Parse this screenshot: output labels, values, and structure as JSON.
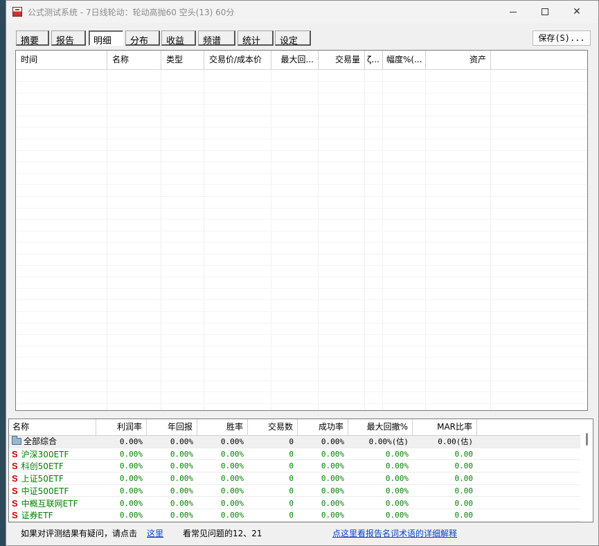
{
  "window": {
    "title": "公式测试系统 - 7日线轮动：轮动高抛60 空头(13) 60分"
  },
  "tabs": [
    "摘要",
    "报告",
    "明细",
    "分布",
    "收益",
    "频谱",
    "统计",
    "设定"
  ],
  "active_tab": "明细",
  "save_label": "保存(S)...",
  "detail_columns": [
    "时间",
    "名称",
    "类型",
    "交易价/成本价",
    "最大回...",
    "交易量",
    "ζ...",
    "幅度%(...",
    "资产"
  ],
  "summary": {
    "columns": [
      "名称",
      "利润率",
      "年回报",
      "胜率",
      "交易数",
      "成功率",
      "最大回撤%",
      "MAR比率"
    ],
    "rows": [
      {
        "name": "全部综合",
        "profit": "0.00%",
        "annual": "0.00%",
        "win": "0.00%",
        "trades": "0",
        "success": "0.00%",
        "drawdown": "0.00%(估)",
        "mar": "0.00(估)"
      },
      {
        "name": "沪深300ETF",
        "profit": "0.00%",
        "annual": "0.00%",
        "win": "0.00%",
        "trades": "0",
        "success": "0.00%",
        "drawdown": "0.00%",
        "mar": "0.00"
      },
      {
        "name": "科创50ETF",
        "profit": "0.00%",
        "annual": "0.00%",
        "win": "0.00%",
        "trades": "0",
        "success": "0.00%",
        "drawdown": "0.00%",
        "mar": "0.00"
      },
      {
        "name": "上证50ETF",
        "profit": "0.00%",
        "annual": "0.00%",
        "win": "0.00%",
        "trades": "0",
        "success": "0.00%",
        "drawdown": "0.00%",
        "mar": "0.00"
      },
      {
        "name": "中证500ETF",
        "profit": "0.00%",
        "annual": "0.00%",
        "win": "0.00%",
        "trades": "0",
        "success": "0.00%",
        "drawdown": "0.00%",
        "mar": "0.00"
      },
      {
        "name": "中概互联网ETF",
        "profit": "0.00%",
        "annual": "0.00%",
        "win": "0.00%",
        "trades": "0",
        "success": "0.00%",
        "drawdown": "0.00%",
        "mar": "0.00"
      },
      {
        "name": "证券ETF",
        "profit": "0.00%",
        "annual": "0.00%",
        "win": "0.00%",
        "trades": "0",
        "success": "0.00%",
        "drawdown": "0.00%",
        "mar": "0.00"
      }
    ],
    "stock_marker": "S"
  },
  "status": {
    "question_text": "如果对评测结果有疑问，请点击",
    "here_link": "这里",
    "faq_text": "看常见问题的12、21",
    "glossary_link": "点这里看报告名词术语的详细解释"
  },
  "colors": {
    "stock_marker": "#d00000",
    "stock_text": "#008000",
    "link": "#0645c8"
  },
  "icons": {
    "app": "app-icon",
    "summary_total": "folder-icon"
  }
}
